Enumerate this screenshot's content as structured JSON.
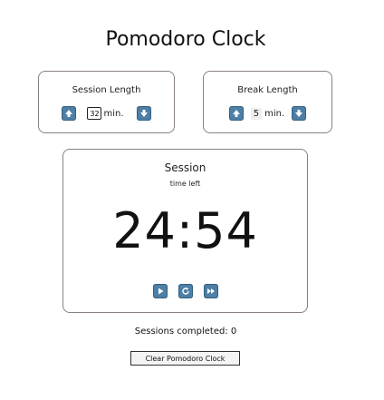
{
  "app": {
    "title": "Pomodoro Clock"
  },
  "session_length": {
    "label": "Session Length",
    "value": "32",
    "unit": "min.",
    "increase_icon": "arrow-up-icon",
    "decrease_icon": "arrow-down-icon"
  },
  "break_length": {
    "label": "Break Length",
    "value": "5",
    "unit": "min.",
    "increase_icon": "arrow-up-icon",
    "decrease_icon": "arrow-down-icon"
  },
  "timer": {
    "mode": "Session",
    "subtitle": "time left",
    "display": "24:54",
    "controls": [
      "play-icon",
      "reset-icon",
      "skip-icon"
    ]
  },
  "footer": {
    "sessions_completed": "Sessions completed: 0",
    "clear_button": "Clear Pomodoro Clock"
  },
  "colors": {
    "button": "#4e7fa6",
    "border": "#8a7f85",
    "text": "#111111"
  }
}
